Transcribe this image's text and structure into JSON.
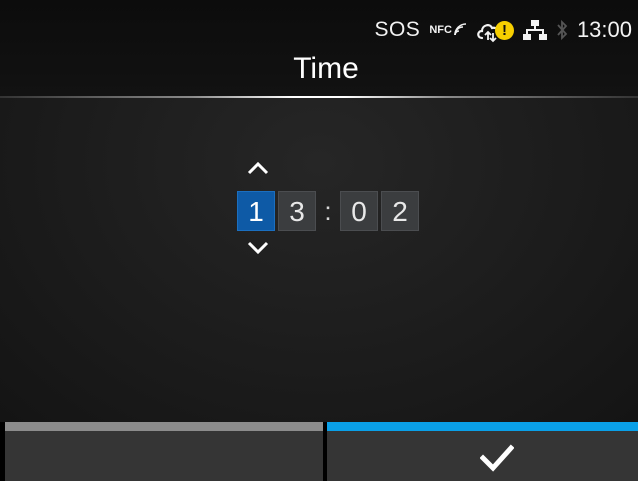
{
  "status_bar": {
    "sos_label": "SOS",
    "nfc_label": "NFC",
    "time": "13:00",
    "icons": [
      "nfc-icon",
      "cloud-sync-icon",
      "warning-icon",
      "network-icon",
      "bluetooth-icon"
    ],
    "warning_mark": "!",
    "warning_color": "#f7cf00"
  },
  "header": {
    "title": "Time"
  },
  "time_editor": {
    "digits": [
      "1",
      "3",
      "0",
      "2"
    ],
    "separator": ":",
    "selected_index": 0,
    "selected_color": "#0e5aa6"
  },
  "softkeys": {
    "left": {
      "strip_color": "#8c8c8c",
      "icon": ""
    },
    "right": {
      "strip_color": "#0aa0e8",
      "icon": "check-icon"
    }
  }
}
